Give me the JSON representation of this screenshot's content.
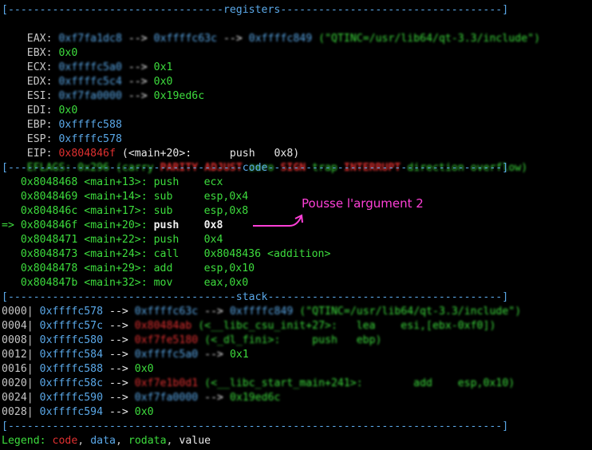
{
  "registers_sep": "[----------------------------------registers-----------------------------------]",
  "regs": [
    {
      "name": "EAX:",
      "v1": "0xf7fa1dc8",
      "a1": "-->",
      "v2": "0xffffc63c",
      "a2": "-->",
      "v3": "0xffffc849",
      "str": "(\"QTINC=/usr/lib64/qt-3.3/include\")"
    },
    {
      "name": "EBX:",
      "v1": "0x0"
    },
    {
      "name": "ECX:",
      "v1": "0xffffc5a0",
      "a1": "-->",
      "v2": "0x1"
    },
    {
      "name": "EDX:",
      "v1": "0xffffc5c4",
      "a1": "-->",
      "v2": "0x0"
    },
    {
      "name": "ESI:",
      "v1": "0xf7fa0000",
      "a1": "-->",
      "v2": "0x19ed6c"
    },
    {
      "name": "EDI:",
      "v1": "0x0"
    },
    {
      "name": "EBP:",
      "v1": "0xffffc588"
    },
    {
      "name": "ESP:",
      "v1": "0xffffc578"
    },
    {
      "name": "EIP:",
      "v1": "0x804846f",
      "rest": "(<main+20>:      push   0x8)"
    }
  ],
  "eflags": {
    "label": "EFLAGS:",
    "value": "0x296",
    "open": "(carry",
    "parity": "PARITY",
    "adjust": "ADJUST",
    "zero": "zero",
    "sign": "SIGN",
    "trap": "trap",
    "interrupt": "INTERRUPT",
    "rest": "direction overflow)"
  },
  "code_sep": "[-------------------------------------code-------------------------------------]",
  "code": [
    {
      "prefix": "   ",
      "addr": "0x8048468",
      "sym": "<main+13>:",
      "op": "push",
      "arg": "ecx"
    },
    {
      "prefix": "   ",
      "addr": "0x8048469",
      "sym": "<main+14>:",
      "op": "sub",
      "arg": "esp,0x4"
    },
    {
      "prefix": "   ",
      "addr": "0x804846c",
      "sym": "<main+17>:",
      "op": "sub",
      "arg": "esp,0x8"
    },
    {
      "prefix": "=> ",
      "addr": "0x804846f",
      "sym": "<main+20>:",
      "op": "push",
      "arg": "0x8"
    },
    {
      "prefix": "   ",
      "addr": "0x8048471",
      "sym": "<main+22>:",
      "op": "push",
      "arg": "0x4"
    },
    {
      "prefix": "   ",
      "addr": "0x8048473",
      "sym": "<main+24>:",
      "op": "call",
      "arg": "0x8048436 <addition>"
    },
    {
      "prefix": "   ",
      "addr": "0x8048478",
      "sym": "<main+29>:",
      "op": "add",
      "arg": "esp,0x10"
    },
    {
      "prefix": "   ",
      "addr": "0x804847b",
      "sym": "<main+32>:",
      "op": "mov",
      "arg": "eax,0x0"
    }
  ],
  "annotation": "Pousse l'argument  2",
  "stack_sep": "[------------------------------------stack-------------------------------------]",
  "stack": [
    {
      "off": "0000|",
      "addr": "0xffffc578",
      "a1": "-->",
      "v1": "0xffffc63c",
      "a2": "-->",
      "v2": "0xffffc849",
      "str": "(\"QTINC=/usr/lib64/qt-3.3/include\")"
    },
    {
      "off": "0004|",
      "addr": "0xffffc57c",
      "a1": "-->",
      "v1": "0x80484ab",
      "str": "(<__libc_csu_init+27>:   lea    esi,[ebx-0xf0])"
    },
    {
      "off": "0008|",
      "addr": "0xffffc580",
      "a1": "-->",
      "v1": "0xf7fe5180",
      "str": "(<_dl_fini>:     push   ebp)"
    },
    {
      "off": "0012|",
      "addr": "0xffffc584",
      "a1": "-->",
      "v1": "0xffffc5a0",
      "a2": "-->",
      "v2": "0x1"
    },
    {
      "off": "0016|",
      "addr": "0xffffc588",
      "a1": "-->",
      "v1": "0x0"
    },
    {
      "off": "0020|",
      "addr": "0xffffc58c",
      "a1": "-->",
      "v1": "0xf7e1b0d1",
      "str": "(<__libc_start_main+241>:        add    esp,0x10)"
    },
    {
      "off": "0024|",
      "addr": "0xffffc590",
      "a1": "-->",
      "v1": "0xf7fa0000",
      "a2": "-->",
      "v2": "0x19ed6c"
    },
    {
      "off": "0028|",
      "addr": "0xffffc594",
      "a1": "-->",
      "v1": "0x0"
    }
  ],
  "end_sep": "[------------------------------------------------------------------------------]",
  "legend": {
    "label": "Legend:",
    "code": "code",
    "c1": ",",
    "data": "data",
    "c2": ",",
    "rodata": "rodata",
    "c3": ",",
    "value": "value"
  }
}
